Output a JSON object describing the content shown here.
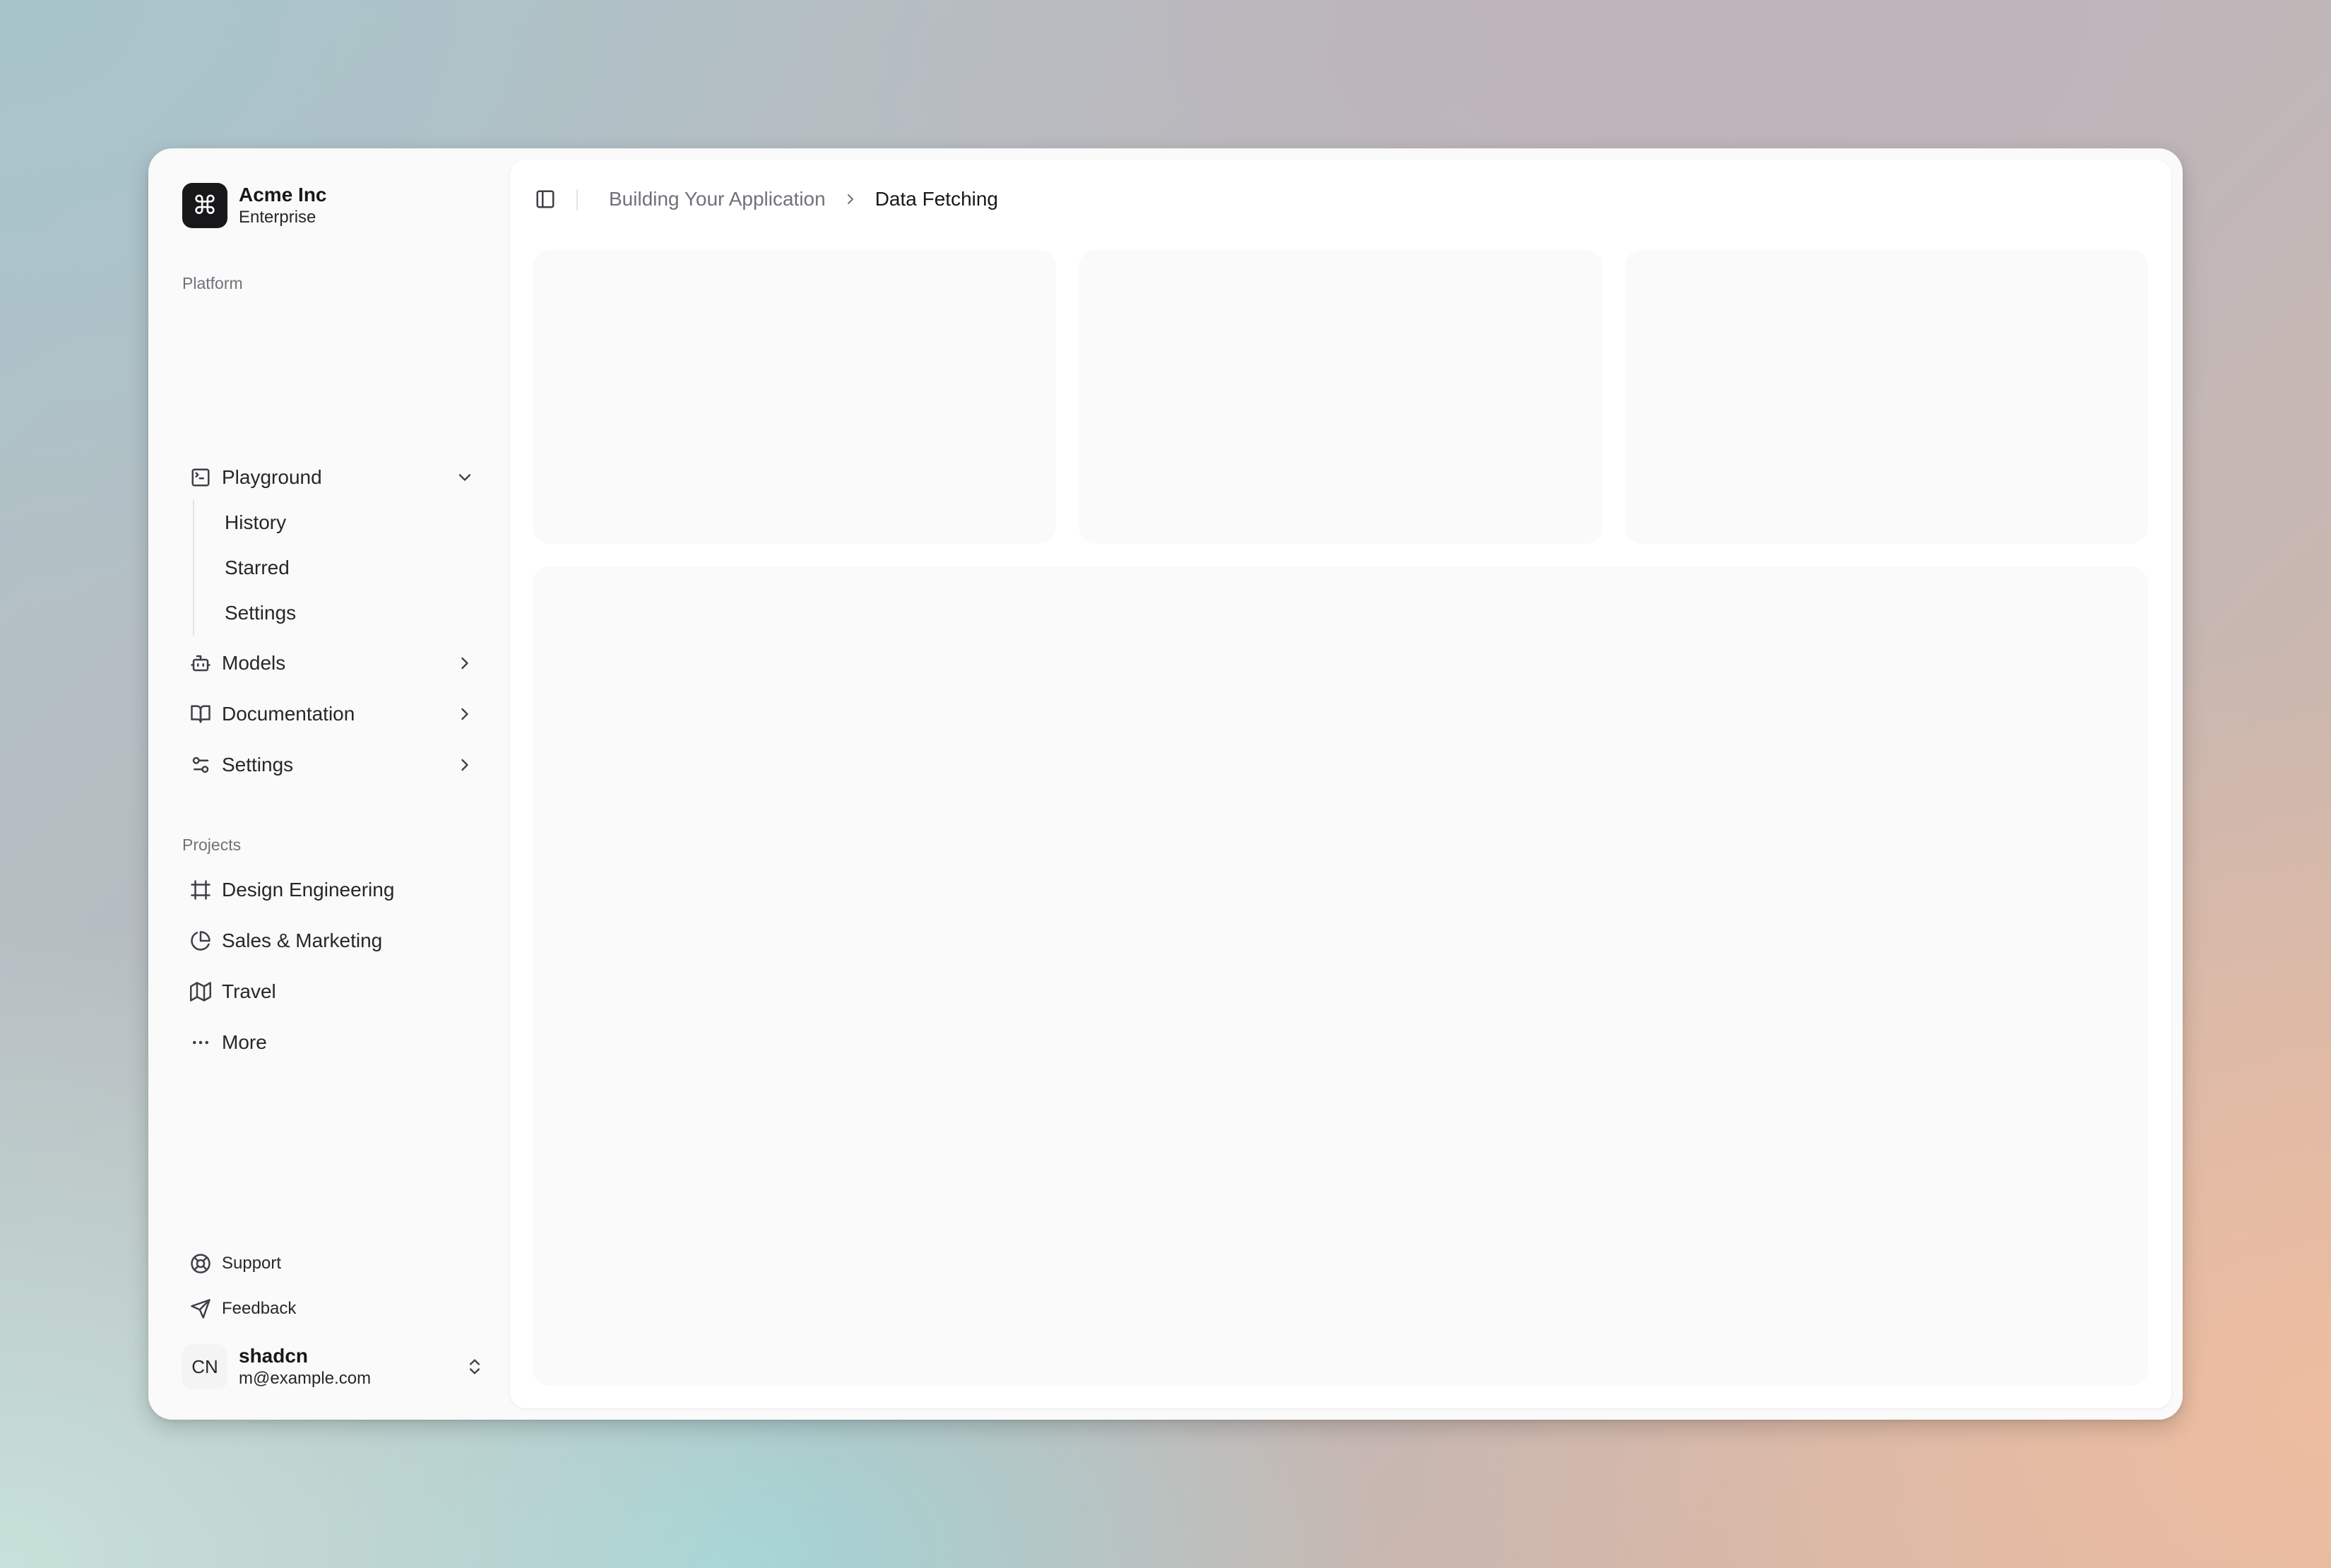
{
  "team": {
    "logo_glyph": "⌘",
    "name": "Acme Inc",
    "plan": "Enterprise"
  },
  "sidebar": {
    "platform_label": "Platform",
    "platform_items": [
      {
        "label": "Playground",
        "icon": "terminal-icon",
        "expanded": true
      },
      {
        "label": "Models",
        "icon": "bot-icon",
        "expanded": false
      },
      {
        "label": "Documentation",
        "icon": "book-open-icon",
        "expanded": false
      },
      {
        "label": "Settings",
        "icon": "settings-sliders-icon",
        "expanded": false
      }
    ],
    "playground_subitems": [
      "History",
      "Starred",
      "Settings"
    ],
    "projects_label": "Projects",
    "project_items": [
      {
        "label": "Design Engineering",
        "icon": "frame-icon"
      },
      {
        "label": "Sales & Marketing",
        "icon": "pie-chart-icon"
      },
      {
        "label": "Travel",
        "icon": "map-icon"
      },
      {
        "label": "More",
        "icon": "more-horizontal-icon"
      }
    ],
    "secondary_items": [
      {
        "label": "Support",
        "icon": "life-buoy-icon"
      },
      {
        "label": "Feedback",
        "icon": "send-icon"
      }
    ],
    "user": {
      "initials": "CN",
      "name": "shadcn",
      "email": "m@example.com"
    }
  },
  "header": {
    "breadcrumb_parent": "Building Your Application",
    "breadcrumb_current": "Data Fetching"
  },
  "colors": {
    "sidebar_bg": "#fafafa",
    "main_bg": "#ffffff",
    "placeholder_card": "#fafafa",
    "logo_bg": "#18181b",
    "muted_text": "#71717a"
  }
}
